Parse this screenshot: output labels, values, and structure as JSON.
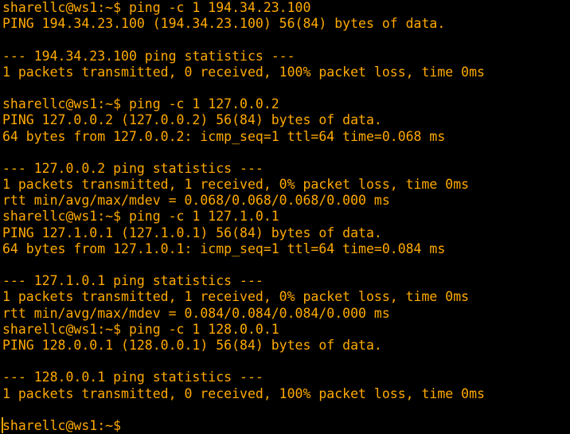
{
  "terminal": {
    "text_color": "#ffaa00",
    "background_color": "#000000",
    "lines": [
      "sharellc@ws1:~$ ping -c 1 194.34.23.100",
      "PING 194.34.23.100 (194.34.23.100) 56(84) bytes of data.",
      "",
      "--- 194.34.23.100 ping statistics ---",
      "1 packets transmitted, 0 received, 100% packet loss, time 0ms",
      "",
      "sharellc@ws1:~$ ping -c 1 127.0.0.2",
      "PING 127.0.0.2 (127.0.0.2) 56(84) bytes of data.",
      "64 bytes from 127.0.0.2: icmp_seq=1 ttl=64 time=0.068 ms",
      "",
      "--- 127.0.0.2 ping statistics ---",
      "1 packets transmitted, 1 received, 0% packet loss, time 0ms",
      "rtt min/avg/max/mdev = 0.068/0.068/0.068/0.000 ms",
      "sharellc@ws1:~$ ping -c 1 127.1.0.1",
      "PING 127.1.0.1 (127.1.0.1) 56(84) bytes of data.",
      "64 bytes from 127.1.0.1: icmp_seq=1 ttl=64 time=0.084 ms",
      "",
      "--- 127.1.0.1 ping statistics ---",
      "1 packets transmitted, 1 received, 0% packet loss, time 0ms",
      "rtt min/avg/max/mdev = 0.084/0.084/0.084/0.000 ms",
      "sharellc@ws1:~$ ping -c 1 128.0.0.1",
      "PING 128.0.0.1 (128.0.0.1) 56(84) bytes of data.",
      "",
      "--- 128.0.0.1 ping statistics ---",
      "1 packets transmitted, 0 received, 100% packet loss, time 0ms",
      "",
      "sharellc@ws1:~$"
    ]
  }
}
